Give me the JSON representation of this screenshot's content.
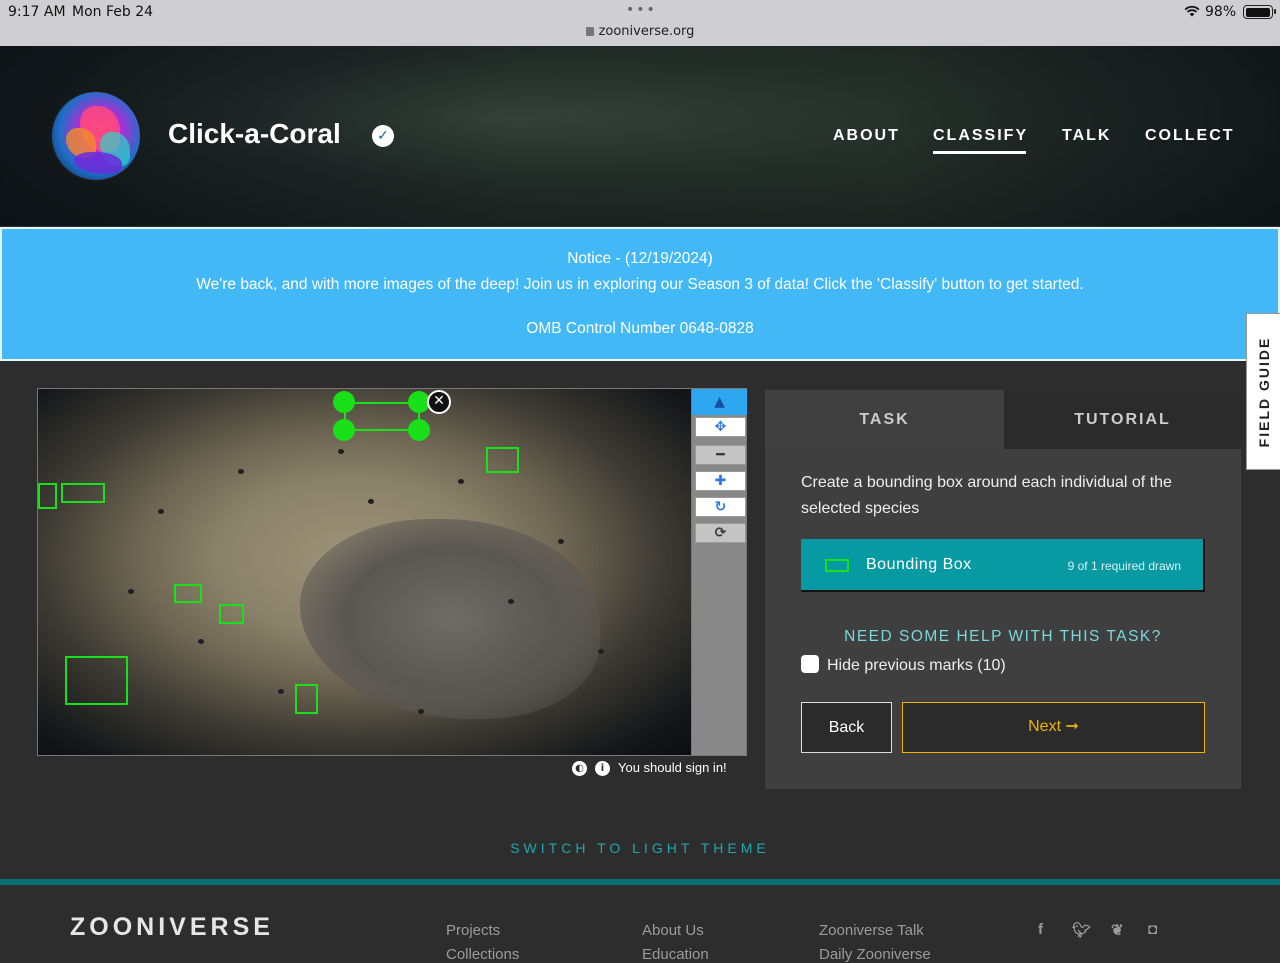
{
  "status_bar": {
    "time": "9:17 AM",
    "date": "Mon Feb 24",
    "url": "zooniverse.org",
    "battery": "98%"
  },
  "project": {
    "title": "Click-a-Coral",
    "nav": [
      "ABOUT",
      "CLASSIFY",
      "TALK",
      "COLLECT"
    ],
    "active_nav": "CLASSIFY"
  },
  "notice": {
    "title": "Notice - (12/19/2024)",
    "message": "We're back, and with more images of the deep! Join us in exploring our Season 3 of data! Click the 'Classify' button to get started.",
    "omb": "OMB Control Number 0648-0828"
  },
  "field_guide": "FIELD GUIDE",
  "viewer": {
    "sign_in": "You should sign in!",
    "tools": [
      "pointer-icon",
      "move-icon",
      "zoom-out-icon",
      "zoom-in-icon",
      "rotate-icon",
      "reset-icon"
    ]
  },
  "task_panel": {
    "tabs": [
      "TASK",
      "TUTORIAL"
    ],
    "instruction": "Create a bounding box around each individual of the selected species",
    "tool_label": "Bounding Box",
    "tool_count": "9 of 1 required drawn",
    "help": "NEED SOME HELP WITH THIS TASK?",
    "hide_marks": "Hide previous marks (10)",
    "back": "Back",
    "next": "Next"
  },
  "theme_switch": "SWITCH TO LIGHT THEME",
  "footer": {
    "brand": "ZOONIVERSE",
    "col1": [
      "Projects",
      "Collections"
    ],
    "col2": [
      "About Us",
      "Education"
    ],
    "col3": [
      "Zooniverse Talk",
      "Daily Zooniverse"
    ],
    "social": [
      "facebook-icon",
      "twitter-icon",
      "bluesky-icon",
      "instagram-icon"
    ]
  },
  "colors": {
    "notice_bg": "#43b8f7",
    "tool_bg": "#079aa3",
    "next_accent": "#f0b200",
    "mark_green": "#19e019",
    "footer_accent": "#0b6f75"
  }
}
